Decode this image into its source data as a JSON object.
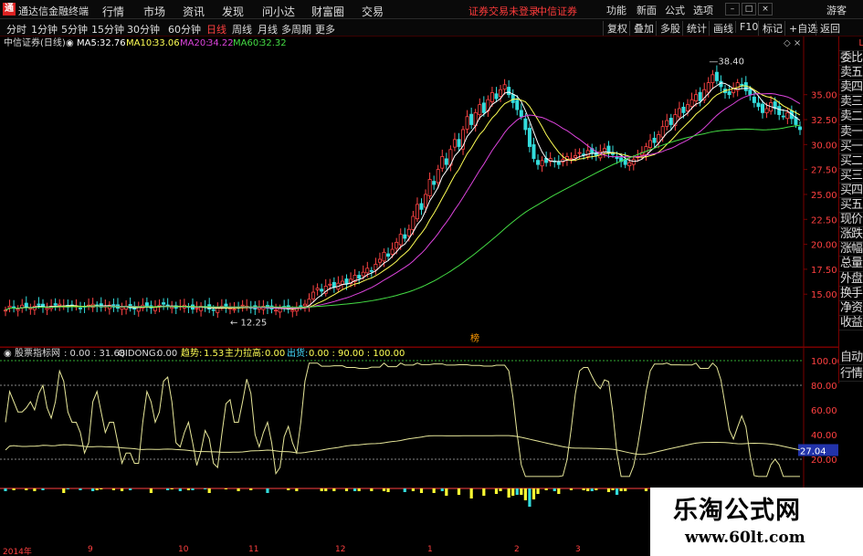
{
  "app": {
    "logo": "通",
    "title": "通达信金融终端",
    "menu": [
      "行情",
      "市场",
      "资讯",
      "发现",
      "问小达",
      "财富圈",
      "交易"
    ],
    "notice": "证券交易未登录",
    "broker": "中信证券",
    "right_links": [
      "功能",
      "新面",
      "公式",
      "选项"
    ],
    "guest": "游客",
    "btn_min": "–",
    "btn_max": "□",
    "btn_close": "×"
  },
  "toolbar": {
    "periods": [
      "分时",
      "1分钟",
      "5分钟",
      "15分钟",
      "30分钟",
      "60分钟",
      "日线",
      "周线",
      "月线",
      "多周期",
      "更多"
    ],
    "active_period": "日线",
    "tools": [
      "复权",
      "叠加",
      "多股",
      "统计",
      "画线",
      "F10",
      "标记",
      "+自选",
      "返回"
    ]
  },
  "chart": {
    "stock_title": "中信证券(日线)",
    "ma": [
      {
        "label": "MA5:",
        "value": "32.76",
        "color": "#ffffff"
      },
      {
        "label": "MA10:",
        "value": "33.06",
        "color": "#ffff55"
      },
      {
        "label": "MA20:",
        "value": "34.22",
        "color": "#dd44dd"
      },
      {
        "label": "MA60:",
        "value": "32.32",
        "color": "#44dd44"
      }
    ],
    "high_label": "38.40",
    "low_label": "12.25",
    "marker": "榜",
    "corner": "◇ ×",
    "yticks": [
      "35.00",
      "32.50",
      "30.00",
      "27.50",
      "25.00",
      "22.50",
      "20.00",
      "17.50",
      "15.00"
    ]
  },
  "sidebar": {
    "corner": "L",
    "items": [
      "委比",
      "卖五",
      "卖四",
      "卖三",
      "卖二",
      "卖一",
      "买一",
      "买二",
      "买三",
      "买四",
      "买五",
      "现价",
      "涨跌",
      "涨幅",
      "总量",
      "外盘",
      "换手",
      "净资",
      "收益"
    ]
  },
  "indicator": {
    "name": "股票指标网",
    "p1": ": 0.00 : 31.68",
    "qd_label": "QIDONG:",
    "qd_value": "0.00",
    "trend_label": "趋势:",
    "trend_value": "1.53",
    "zl_label": "主力拉高:",
    "zl_value": "0.00",
    "ch_label": "出货:",
    "ch_value": "0.00 : 90.00 : 100.00",
    "yticks": [
      "100.00",
      "80.00",
      "60.00",
      "40.00",
      "20.00"
    ],
    "current": "27.04"
  },
  "side_bottom": {
    "items": [
      "自动",
      "行情"
    ]
  },
  "xaxis": {
    "labels": [
      "2014年",
      "9",
      "10",
      "11",
      "12",
      "1",
      "2",
      "3"
    ]
  },
  "watermark": {
    "line1": "乐淘公式网",
    "line2": "www.60lt.com"
  },
  "chart_data": {
    "type": "line",
    "title": "中信证券(日线)",
    "close": [
      13.4,
      13.8,
      13.6,
      13.5,
      13.9,
      13.7,
      13.6,
      13.8,
      13.9,
      13.7,
      13.6,
      13.8,
      13.9,
      14.0,
      13.8,
      13.7,
      13.9,
      13.8,
      13.6,
      13.7,
      13.9,
      14.0,
      13.8,
      13.7,
      13.8,
      13.9,
      13.7,
      13.6,
      13.7,
      13.8,
      13.6,
      13.5,
      13.7,
      13.9,
      13.8,
      13.6,
      13.7,
      13.9,
      14.0,
      13.8,
      13.7,
      13.6,
      13.8,
      13.9,
      13.7,
      13.5,
      13.6,
      13.8,
      13.7,
      13.5,
      13.4,
      13.6,
      13.8,
      13.7,
      13.6,
      13.5,
      13.7,
      13.9,
      13.8,
      13.6,
      13.5,
      13.7,
      13.8,
      13.6,
      13.5,
      13.4,
      13.6,
      13.7,
      13.5,
      13.4,
      13.6,
      13.8,
      14.0,
      14.5,
      15.2,
      15.6,
      15.3,
      15.8,
      16.0,
      15.7,
      16.1,
      16.3,
      16.0,
      16.5,
      16.9,
      16.6,
      17.2,
      17.6,
      17.3,
      18.0,
      18.5,
      19.2,
      18.8,
      19.5,
      20.2,
      21.0,
      20.6,
      21.5,
      22.8,
      24.0,
      23.5,
      25.0,
      26.5,
      26.0,
      27.5,
      28.8,
      28.0,
      29.5,
      30.5,
      29.8,
      31.5,
      32.8,
      32.0,
      33.2,
      34.0,
      33.2,
      34.5,
      35.2,
      34.6,
      35.5,
      36.0,
      35.0,
      34.2,
      33.5,
      32.8,
      31.5,
      29.8,
      28.6,
      28.0,
      28.4,
      28.2,
      28.6,
      28.3,
      28.0,
      28.5,
      28.8,
      28.6,
      28.9,
      29.2,
      29.0,
      29.4,
      29.1,
      28.9,
      29.3,
      29.6,
      29.2,
      29.0,
      28.6,
      28.3,
      28.0,
      28.2,
      28.5,
      28.8,
      29.2,
      29.8,
      30.4,
      30.2,
      31.0,
      31.8,
      32.4,
      32.0,
      33.0,
      33.6,
      33.2,
      34.0,
      34.5,
      35.0,
      34.4,
      35.5,
      36.2,
      37.0,
      36.4,
      35.8,
      35.2,
      35.0,
      35.6,
      36.2,
      36.0,
      35.4,
      35.0,
      34.2,
      33.8,
      33.2,
      33.6,
      34.2,
      33.6,
      33.0,
      32.8,
      33.2,
      32.6,
      32.0,
      31.5
    ],
    "ylim": [
      12,
      39
    ],
    "indicator_ylim": [
      0,
      100
    ]
  }
}
